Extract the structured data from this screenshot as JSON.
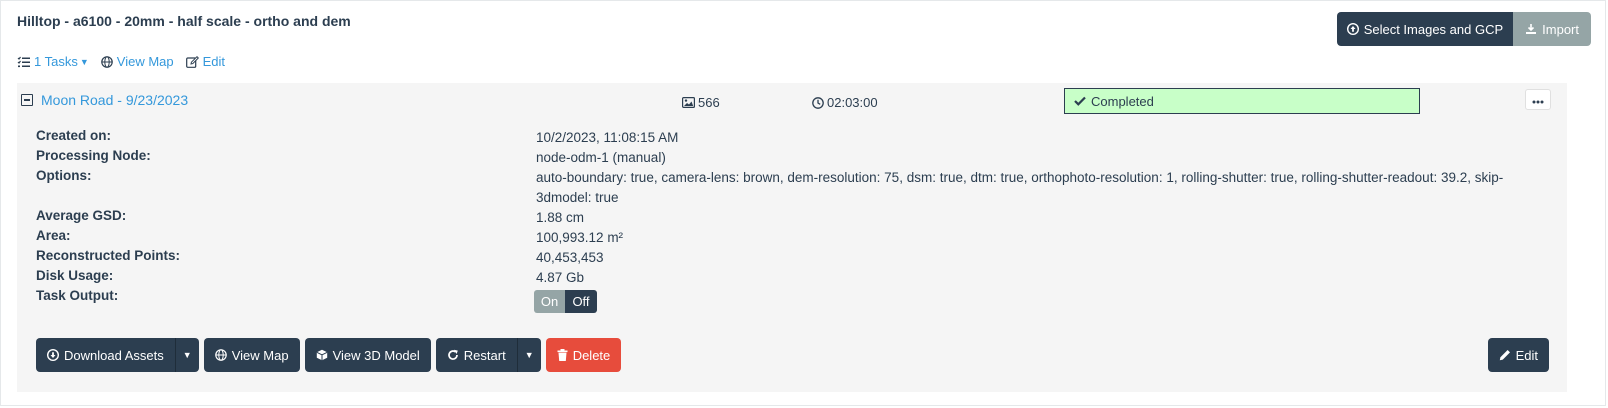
{
  "project": {
    "title": "Hilltop - a6100 - 20mm - half scale - ortho and dem",
    "select_images_label": "Select Images and GCP",
    "import_label": "Import",
    "tasks_label": "1 Tasks",
    "view_map_label": "View Map",
    "edit_label": "Edit"
  },
  "task": {
    "name": "Moon Road - 9/23/2023",
    "image_count": "566",
    "duration": "02:03:00",
    "status": "Completed",
    "details": [
      {
        "label": "Created on:",
        "value": "10/2/2023, 11:08:15 AM"
      },
      {
        "label": "Processing Node:",
        "value": "node-odm-1 (manual)"
      },
      {
        "label": "Options:",
        "value": "auto-boundary: true, camera-lens: brown, dem-resolution: 75, dsm: true, dtm: true, orthophoto-resolution: 1, rolling-shutter: true, rolling-shutter-readout: 39.2, skip-3dmodel: true"
      },
      {
        "label": "Average GSD:",
        "value": "1.88 cm"
      },
      {
        "label": "Area:",
        "value": "100,993.12 m²"
      },
      {
        "label": "Reconstructed Points:",
        "value": "40,453,453"
      },
      {
        "label": "Disk Usage:",
        "value": "4.87 Gb"
      },
      {
        "label": "Task Output:",
        "value": ""
      }
    ],
    "output_toggle": {
      "on_label": "On",
      "off_label": "Off"
    },
    "actions": {
      "download_label": "Download Assets",
      "view_map_label": "View Map",
      "view_3d_label": "View 3D Model",
      "restart_label": "Restart",
      "delete_label": "Delete",
      "edit_label": "Edit"
    }
  },
  "colors": {
    "primary": "#2c3e50",
    "link": "#3498db",
    "muted_button": "#95a5a6",
    "danger": "#e74c3c",
    "completed_bg": "#c8ffc8",
    "panel_bg": "#f5f5f5"
  },
  "icons": [
    "upload-circle-icon",
    "import-icon",
    "list-icon",
    "globe-icon",
    "edit-icon",
    "minus-square-icon",
    "image-icon",
    "clock-icon",
    "check-icon",
    "ellipsis-icon",
    "download-circle-icon",
    "cube-icon",
    "restart-icon",
    "trash-icon",
    "pencil-icon"
  ]
}
